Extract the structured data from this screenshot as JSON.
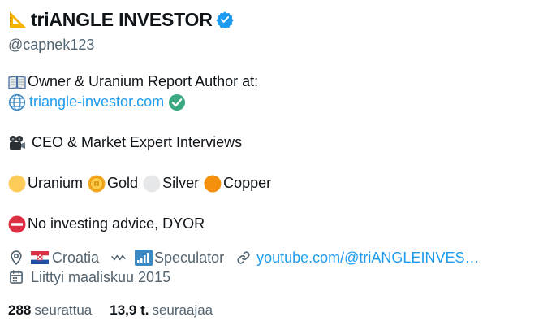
{
  "profile": {
    "display_name": "triANGLE INVESTOR",
    "handle": "@capnek123",
    "bio": {
      "line1_text": "Owner & Uranium Report Author at:",
      "line2_link": "triangle-investor.com",
      "line3_text": "CEO & Market Expert Interviews",
      "line4_items": [
        "Uranium",
        "Gold",
        "Silver",
        "Copper"
      ],
      "line5_text": "No investing advice, DYOR"
    },
    "meta": {
      "location": "Croatia",
      "occupation": "Speculator",
      "website": "youtube.com/@triANGLEINVES…",
      "joined": "Liittyi maaliskuu 2015"
    },
    "stats": {
      "following_count": "288",
      "following_label": "seurattua",
      "followers_count": "13,9 t.",
      "followers_label": "seuraajaa"
    }
  },
  "colors": {
    "link": "#1d9bf0",
    "secondary_text": "#536471",
    "primary_text": "#0f1419",
    "verified": "#1d9bf0"
  },
  "icons": {
    "name_prefix": "triangular-ruler-icon",
    "verified": "verified-badge-icon",
    "bio_line1": "open-book-icon",
    "bio_line2": "globe-icon",
    "bio_line2_suffix": "check-mark-button-icon",
    "bio_line3": "film-projector-icon",
    "uranium": "yellow-circle-icon",
    "gold": "gold-coin-icon",
    "silver": "white-circle-icon",
    "copper": "orange-circle-icon",
    "no_entry": "no-entry-icon",
    "location": "location-pin-icon",
    "flag": "croatia-flag-icon",
    "occupation_prefix": "wave-icon",
    "occupation_emoji": "bar-chart-icon",
    "website": "link-icon",
    "joined": "calendar-icon"
  }
}
